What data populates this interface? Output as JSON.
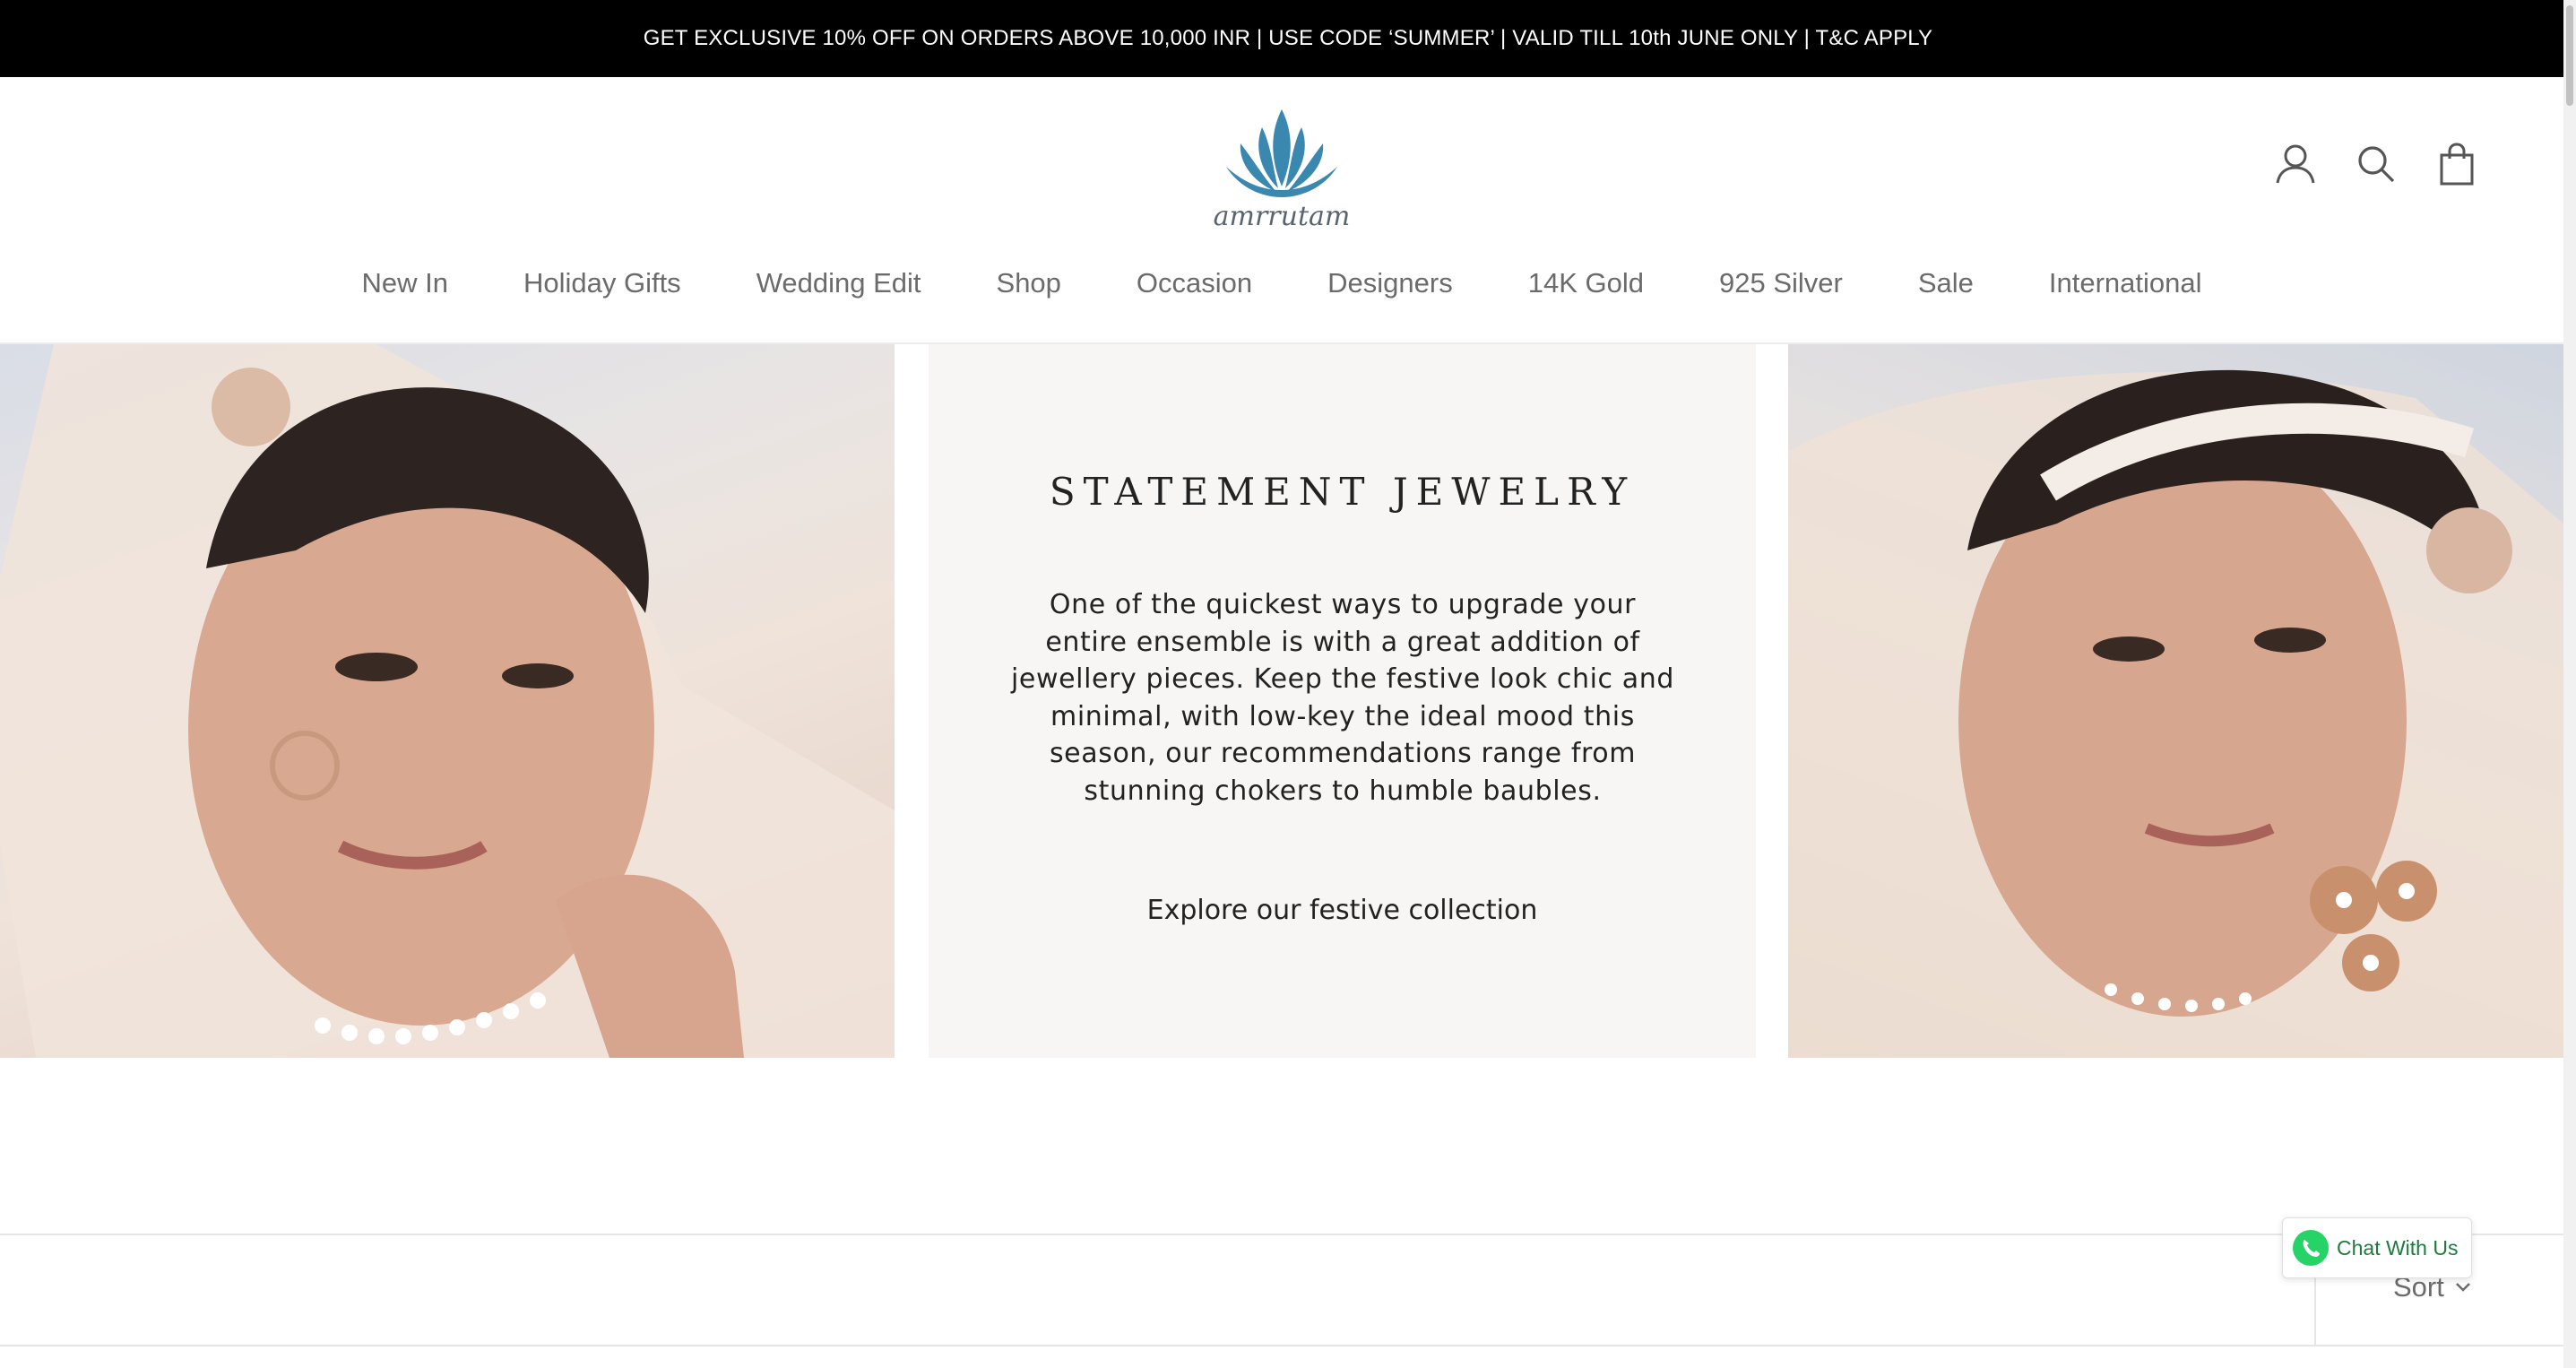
{
  "promo": {
    "text": "GET EXCLUSIVE 10% OFF ON ORDERS ABOVE 10,000 INR | USE CODE ‘SUMMER’ | VALID TILL 10th JUNE ONLY | T&C APPLY"
  },
  "header": {
    "logo_text": "amrrutam",
    "icons": [
      "account-icon",
      "search-icon",
      "bag-icon"
    ],
    "brand_color": "#3a87b0"
  },
  "nav": {
    "items": [
      {
        "label": "New In"
      },
      {
        "label": "Holiday Gifts"
      },
      {
        "label": "Wedding Edit"
      },
      {
        "label": "Shop"
      },
      {
        "label": "Occasion"
      },
      {
        "label": "Designers"
      },
      {
        "label": "14K Gold"
      },
      {
        "label": "925 Silver"
      },
      {
        "label": "Sale"
      },
      {
        "label": "International"
      }
    ]
  },
  "hero": {
    "title": "STATEMENT JEWELRY",
    "body_lines": [
      "One of the quickest ways to upgrade your",
      "entire ensemble is with a great addition of",
      "jewellery pieces. Keep the festive look chic and",
      "minimal, with low-key the ideal mood this",
      "season, our recommendations range from",
      "stunning chokers to humble baubles."
    ],
    "cta": "Explore our festive collection"
  },
  "toolbar": {
    "sort_label": "Sort"
  },
  "chat": {
    "label": "Chat With Us",
    "color": "#25d366"
  }
}
